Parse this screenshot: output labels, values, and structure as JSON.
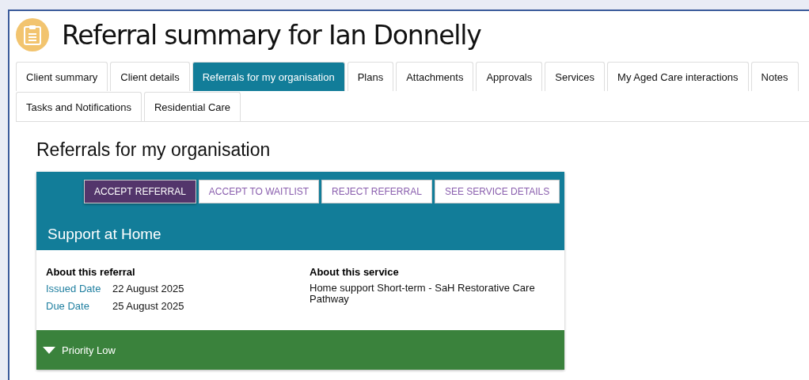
{
  "page_title": "Referral summary for Ian Donnelly",
  "tabs": [
    {
      "label": "Client summary",
      "selected": false
    },
    {
      "label": "Client details",
      "selected": false
    },
    {
      "label": "Referrals for my organisation",
      "selected": true
    },
    {
      "label": "Plans",
      "selected": false
    },
    {
      "label": "Attachments",
      "selected": false
    },
    {
      "label": "Approvals",
      "selected": false
    },
    {
      "label": "Services",
      "selected": false
    },
    {
      "label": "My Aged Care interactions",
      "selected": false
    },
    {
      "label": "Notes",
      "selected": false
    },
    {
      "label": "Tasks and Notifications",
      "selected": false
    },
    {
      "label": "Residential Care",
      "selected": false
    }
  ],
  "section_title": "Referrals for my organisation",
  "referral_card": {
    "actions": [
      {
        "label": "ACCEPT REFERRAL",
        "kind": "primary"
      },
      {
        "label": "ACCEPT TO WAITLIST",
        "kind": "outline"
      },
      {
        "label": "REJECT REFERRAL",
        "kind": "outline"
      },
      {
        "label": "SEE SERVICE DETAILS",
        "kind": "outline"
      }
    ],
    "program": "Support at Home",
    "about_referral": {
      "heading": "About this referral",
      "fields": [
        {
          "label": "Issued Date",
          "value": "22 August 2025"
        },
        {
          "label": "Due Date",
          "value": "25 August 2025"
        }
      ]
    },
    "about_service": {
      "heading": "About this service",
      "description": "Home support Short-term - SaH Restorative Care Pathway"
    },
    "priority": "Priority Low"
  }
}
